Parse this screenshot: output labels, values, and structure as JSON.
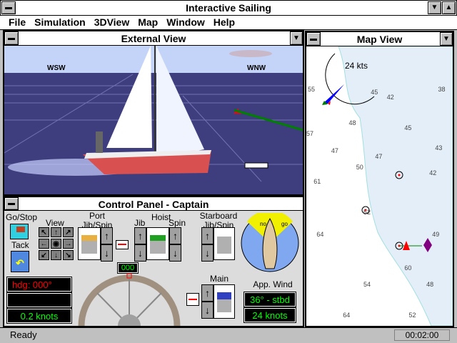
{
  "app": {
    "title": "Interactive Sailing"
  },
  "menu": [
    "File",
    "Simulation",
    "3DView",
    "Map",
    "Window",
    "Help"
  ],
  "external_view": {
    "title": "External View",
    "compass_left": "WSW",
    "compass_right": "WNW"
  },
  "control_panel": {
    "title": "Control Panel - Captain",
    "go_stop": "Go/Stop",
    "tack": "Tack",
    "view": "View",
    "port_label": "Port Jib/Spin",
    "hoist": "Hoist",
    "jib": "Jib",
    "spin": "Spin",
    "starboard_label": "Starboard Jib/Spin",
    "main": "Main",
    "app_wind": "App. Wind",
    "wind_angle": "36° - stbd",
    "wind_speed": "24 knots",
    "heading": "hdg: 000°",
    "speed": "0.2 knots",
    "rudder": "000",
    "wind_no": "no",
    "wind_go": "go"
  },
  "map_view": {
    "title": "Map View",
    "wind_kts": "24 kts",
    "depths": [
      [
        "45",
        "44%",
        "15%"
      ],
      [
        "42",
        "55%",
        "17%"
      ],
      [
        "38",
        "90%",
        "14%"
      ],
      [
        "55",
        "1%",
        "14%"
      ],
      [
        "48",
        "29%",
        "26%"
      ],
      [
        "57",
        "0%",
        "30%"
      ],
      [
        "45",
        "67%",
        "28%"
      ],
      [
        "47",
        "17%",
        "36%"
      ],
      [
        "43",
        "88%",
        "35%"
      ],
      [
        "47",
        "47%",
        "38%"
      ],
      [
        "50",
        "34%",
        "42%"
      ],
      [
        "42",
        "84%",
        "44%"
      ],
      [
        "61",
        "5%",
        "47%"
      ],
      [
        "52",
        "39%",
        "58%"
      ],
      [
        "64",
        "7%",
        "66%"
      ],
      [
        "49",
        "86%",
        "66%"
      ],
      [
        "60",
        "67%",
        "78%"
      ],
      [
        "54",
        "39%",
        "84%"
      ],
      [
        "48",
        "82%",
        "84%"
      ],
      [
        "64",
        "25%",
        "95%"
      ],
      [
        "52",
        "70%",
        "95%"
      ]
    ]
  },
  "status": {
    "text": "Ready",
    "time": "00:02:00"
  },
  "colors": {
    "lcd_green": "#00ff00",
    "lcd_red": "#ff0000",
    "sky": "#c4d4f8",
    "sea": "#3c3c7c",
    "hull": "#d85050"
  }
}
